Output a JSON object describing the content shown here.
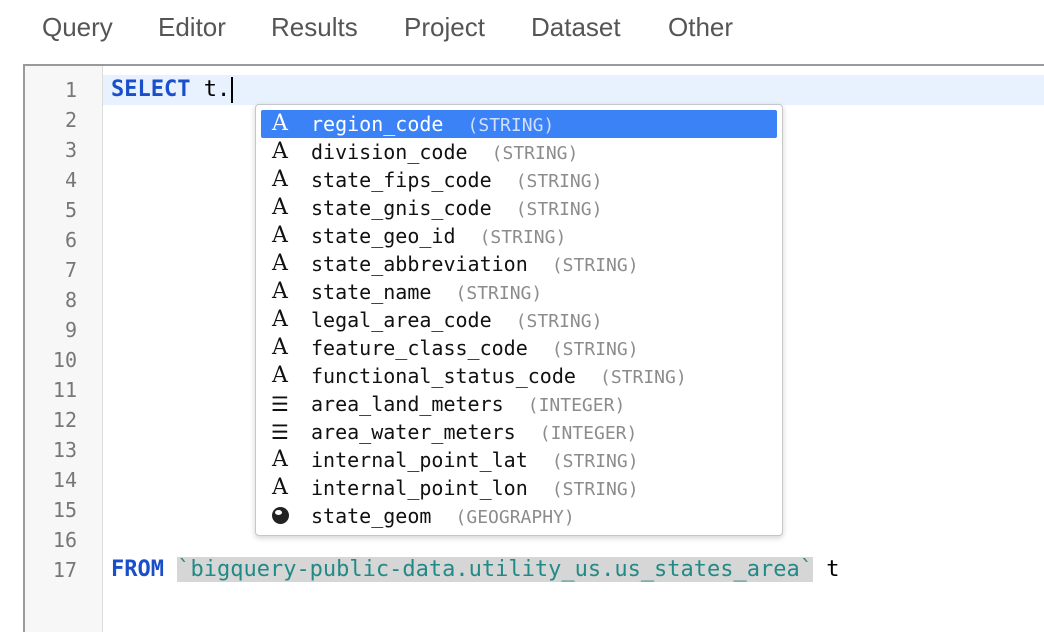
{
  "menu": [
    "Query",
    "Editor",
    "Results",
    "Project",
    "Dataset",
    "Other"
  ],
  "line_numbers": [
    "1",
    "2",
    "3",
    "4",
    "5",
    "6",
    "7",
    "8",
    "9",
    "10",
    "11",
    "12",
    "13",
    "14",
    "15",
    "16",
    "17"
  ],
  "code": {
    "line1_keyword": "SELECT",
    "line1_text": " t.",
    "line17_keyword": "FROM",
    "line17_table": "`bigquery-public-data.utility_us.us_states_area`",
    "line17_alias": " t"
  },
  "autocomplete": {
    "selected_index": 0,
    "items": [
      {
        "icon": "string-icon",
        "name": "region_code",
        "type": "(STRING)"
      },
      {
        "icon": "string-icon",
        "name": "division_code",
        "type": "(STRING)"
      },
      {
        "icon": "string-icon",
        "name": "state_fips_code",
        "type": "(STRING)"
      },
      {
        "icon": "string-icon",
        "name": "state_gnis_code",
        "type": "(STRING)"
      },
      {
        "icon": "string-icon",
        "name": "state_geo_id",
        "type": "(STRING)"
      },
      {
        "icon": "string-icon",
        "name": "state_abbreviation",
        "type": "(STRING)"
      },
      {
        "icon": "string-icon",
        "name": "state_name",
        "type": "(STRING)"
      },
      {
        "icon": "string-icon",
        "name": "legal_area_code",
        "type": "(STRING)"
      },
      {
        "icon": "string-icon",
        "name": "feature_class_code",
        "type": "(STRING)"
      },
      {
        "icon": "string-icon",
        "name": "functional_status_code",
        "type": "(STRING)"
      },
      {
        "icon": "integer-icon",
        "name": "area_land_meters",
        "type": "(INTEGER)"
      },
      {
        "icon": "integer-icon",
        "name": "area_water_meters",
        "type": "(INTEGER)"
      },
      {
        "icon": "string-icon",
        "name": "internal_point_lat",
        "type": "(STRING)"
      },
      {
        "icon": "string-icon",
        "name": "internal_point_lon",
        "type": "(STRING)"
      },
      {
        "icon": "geography-icon",
        "name": "state_geom",
        "type": "(GEOGRAPHY)"
      }
    ]
  },
  "colors": {
    "keyword": "#1a4fc9",
    "string_literal": "#228a86",
    "selection": "#3b82f6",
    "active_line": "#e8f2ff"
  }
}
